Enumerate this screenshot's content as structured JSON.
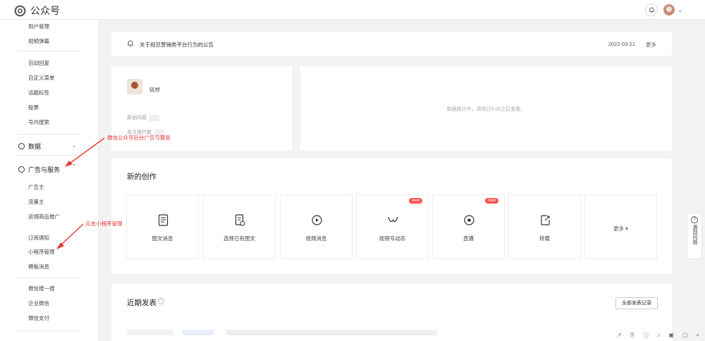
{
  "topbar": {
    "brand": "公众号"
  },
  "sidebar": {
    "group1": [
      "用户管理",
      "视频弹幕"
    ],
    "group2": [
      "自动回复",
      "自定义菜单",
      "话题标签",
      "投票",
      "号内搜索"
    ],
    "data_section": "数据",
    "ads_section": "广告与服务",
    "group3": [
      "广告主",
      "流量主",
      "返佣商品推广",
      "订阅通知",
      "小程序管理",
      "模板消息"
    ],
    "group4": [
      "微信搜一搜",
      "企业微信",
      "微信支付"
    ]
  },
  "notice": {
    "text": "关于规范营销类平台行为的公告",
    "date": "2022-03-21",
    "more": "更多"
  },
  "account": {
    "name": "链想",
    "line1": "原创内容",
    "line2": "关注用户数"
  },
  "stats": {
    "message": "数据统计中，请明日9:00之后查看。"
  },
  "create": {
    "title": "新的创作",
    "items": [
      {
        "label": "图文消息",
        "icon": "article-icon"
      },
      {
        "label": "选择已有图文",
        "icon": "select-article-icon"
      },
      {
        "label": "视频消息",
        "icon": "video-icon"
      },
      {
        "label": "视频号动态",
        "icon": "channels-icon",
        "badge": "new"
      },
      {
        "label": "直播",
        "icon": "live-icon",
        "badge": "new"
      },
      {
        "label": "转载",
        "icon": "repost-icon"
      }
    ],
    "more": "更多 ▾"
  },
  "recent": {
    "title": "近期发表",
    "help": "?",
    "records_button": "全部发表记录"
  },
  "feedback": {
    "icon": "?",
    "label": "遇到问题"
  },
  "annotations": {
    "ads": "微信公众号后台广告与服务",
    "miniprogram": "点击小程序管理"
  },
  "colors": {
    "annotation": "#e53935",
    "badge": "#fa5151"
  }
}
